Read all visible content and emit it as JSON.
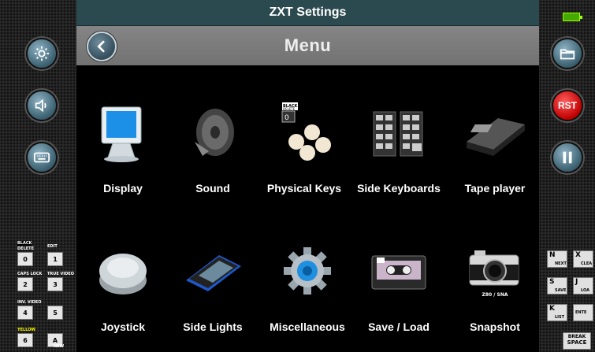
{
  "window": {
    "title": "ZXT Settings"
  },
  "header": {
    "menu_title": "Menu",
    "back_icon": "chevron-left-icon"
  },
  "left_rail": {
    "buttons": [
      {
        "name": "settings-gear-icon"
      },
      {
        "name": "speaker-icon"
      },
      {
        "name": "keyboard-icon"
      }
    ],
    "keys": [
      {
        "main": "0",
        "top": "BLACK",
        "sub": "DELETE"
      },
      {
        "main": "1",
        "top": "EDIT",
        "sub": ""
      },
      {
        "main": "2",
        "top": "CAPS LOCK",
        "sub": ""
      },
      {
        "main": "3",
        "top": "TRUE VIDEO",
        "sub": ""
      },
      {
        "main": "4",
        "top": "INV. VIDEO",
        "sub": ""
      },
      {
        "main": "5",
        "top": "",
        "sub": ""
      },
      {
        "main": "6",
        "top": "YELLOW",
        "sub": ""
      },
      {
        "main": "A",
        "top": "",
        "sub": "NEW"
      }
    ]
  },
  "right_rail": {
    "rst_label": "RST",
    "keys": [
      {
        "letter": "N",
        "word": "NEXT"
      },
      {
        "letter": "X",
        "word": "CLEA"
      },
      {
        "letter": "S",
        "word": "SAVE"
      },
      {
        "letter": "J",
        "word": "LOA"
      },
      {
        "letter": "K",
        "word": "LIST"
      },
      {
        "letter": "",
        "word": "ENTE"
      }
    ],
    "break_space": [
      "BREAK",
      "SPACE"
    ]
  },
  "menu_items": [
    {
      "label": "Display"
    },
    {
      "label": "Sound"
    },
    {
      "label": "Physical Keys"
    },
    {
      "label": "Side Keyboards"
    },
    {
      "label": "Tape player"
    },
    {
      "label": "Joystick"
    },
    {
      "label": "Side Lights"
    },
    {
      "label": "Miscellaneous"
    },
    {
      "label": "Save / Load"
    },
    {
      "label": "Snapshot"
    }
  ],
  "snapshot_icon_text": "Z80 / SNA",
  "physical_keys_icon_text": [
    "BLACK",
    "DELETE",
    "0"
  ],
  "colors": {
    "titlebar": "#2b4a4f",
    "menubar": "#7a7a7a",
    "accent_blue": "#3f6474",
    "rst_red": "#c00000"
  }
}
